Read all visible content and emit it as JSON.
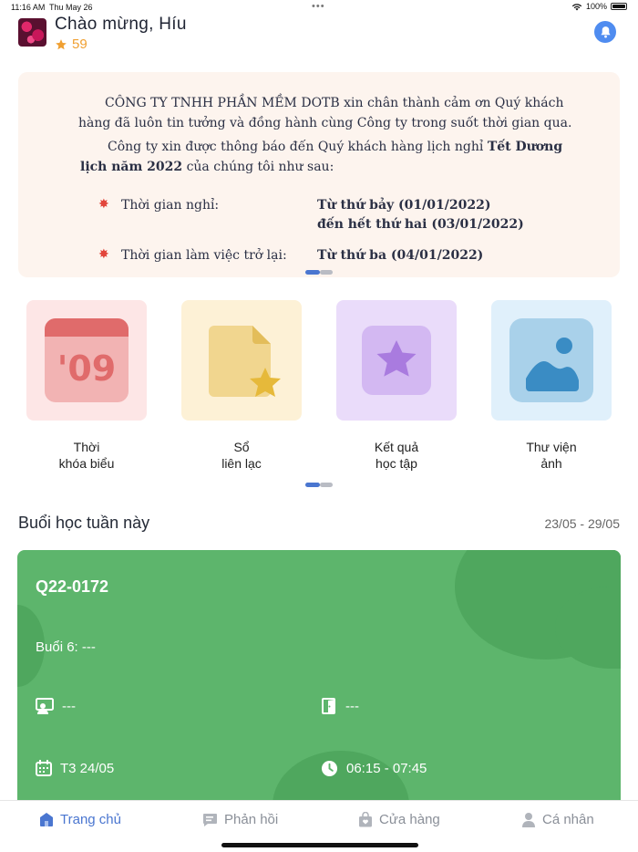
{
  "status_bar": {
    "time": "11:16 AM",
    "date": "Thu May 26",
    "dots": "•••",
    "battery": "100%"
  },
  "header": {
    "greeting": "Chào mừng, Híu",
    "points": "59"
  },
  "banner": {
    "cut_top": "⁓ ⁓ ⁓   ⁓",
    "line1": "CÔNG TY TNHH PHẦN MỀM DOTB xin chân thành cảm ơn Quý khách",
    "line2": "hàng đã luôn tin tưởng và đồng hành cùng Công ty trong suốt thời gian qua.",
    "line3_start": "Công ty xin được thông báo đến Quý khách hàng lịch nghỉ ",
    "line3_bold": "Tết Dương",
    "line4_bold": "lịch năm 2022",
    "line4_end": " của chúng tôi như sau:",
    "rest_label": "Thời gian nghỉ:",
    "rest_from": "Từ thứ bảy (01/01/2022)",
    "rest_to": "đến hết thứ hai (03/01/2022)",
    "return_label": "Thời gian làm việc trở lại:",
    "return_value": "Từ thứ ba (04/01/2022)"
  },
  "tiles": [
    {
      "line1": "Thời",
      "line2": "khóa biểu",
      "calendar_text": "'09"
    },
    {
      "line1": "Sổ",
      "line2": "liên lạc"
    },
    {
      "line1": "Kết quả",
      "line2": "học tập"
    },
    {
      "line1": "Thư viện",
      "line2": "ảnh"
    }
  ],
  "section": {
    "title": "Buổi học tuần này",
    "range": "23/05 - 29/05"
  },
  "lesson": {
    "code": "Q22-0172",
    "session": "Buổi 6: ---",
    "teacher": "---",
    "room": "---",
    "date": "T3 24/05",
    "time": "06:15 - 07:45"
  },
  "nav": {
    "home": "Trang chủ",
    "feedback": "Phản hồi",
    "store": "Cửa hàng",
    "profile": "Cá nhân"
  },
  "colors": {
    "accent": "#4a76d0",
    "card": "#5db56c",
    "star": "#f0a032"
  }
}
